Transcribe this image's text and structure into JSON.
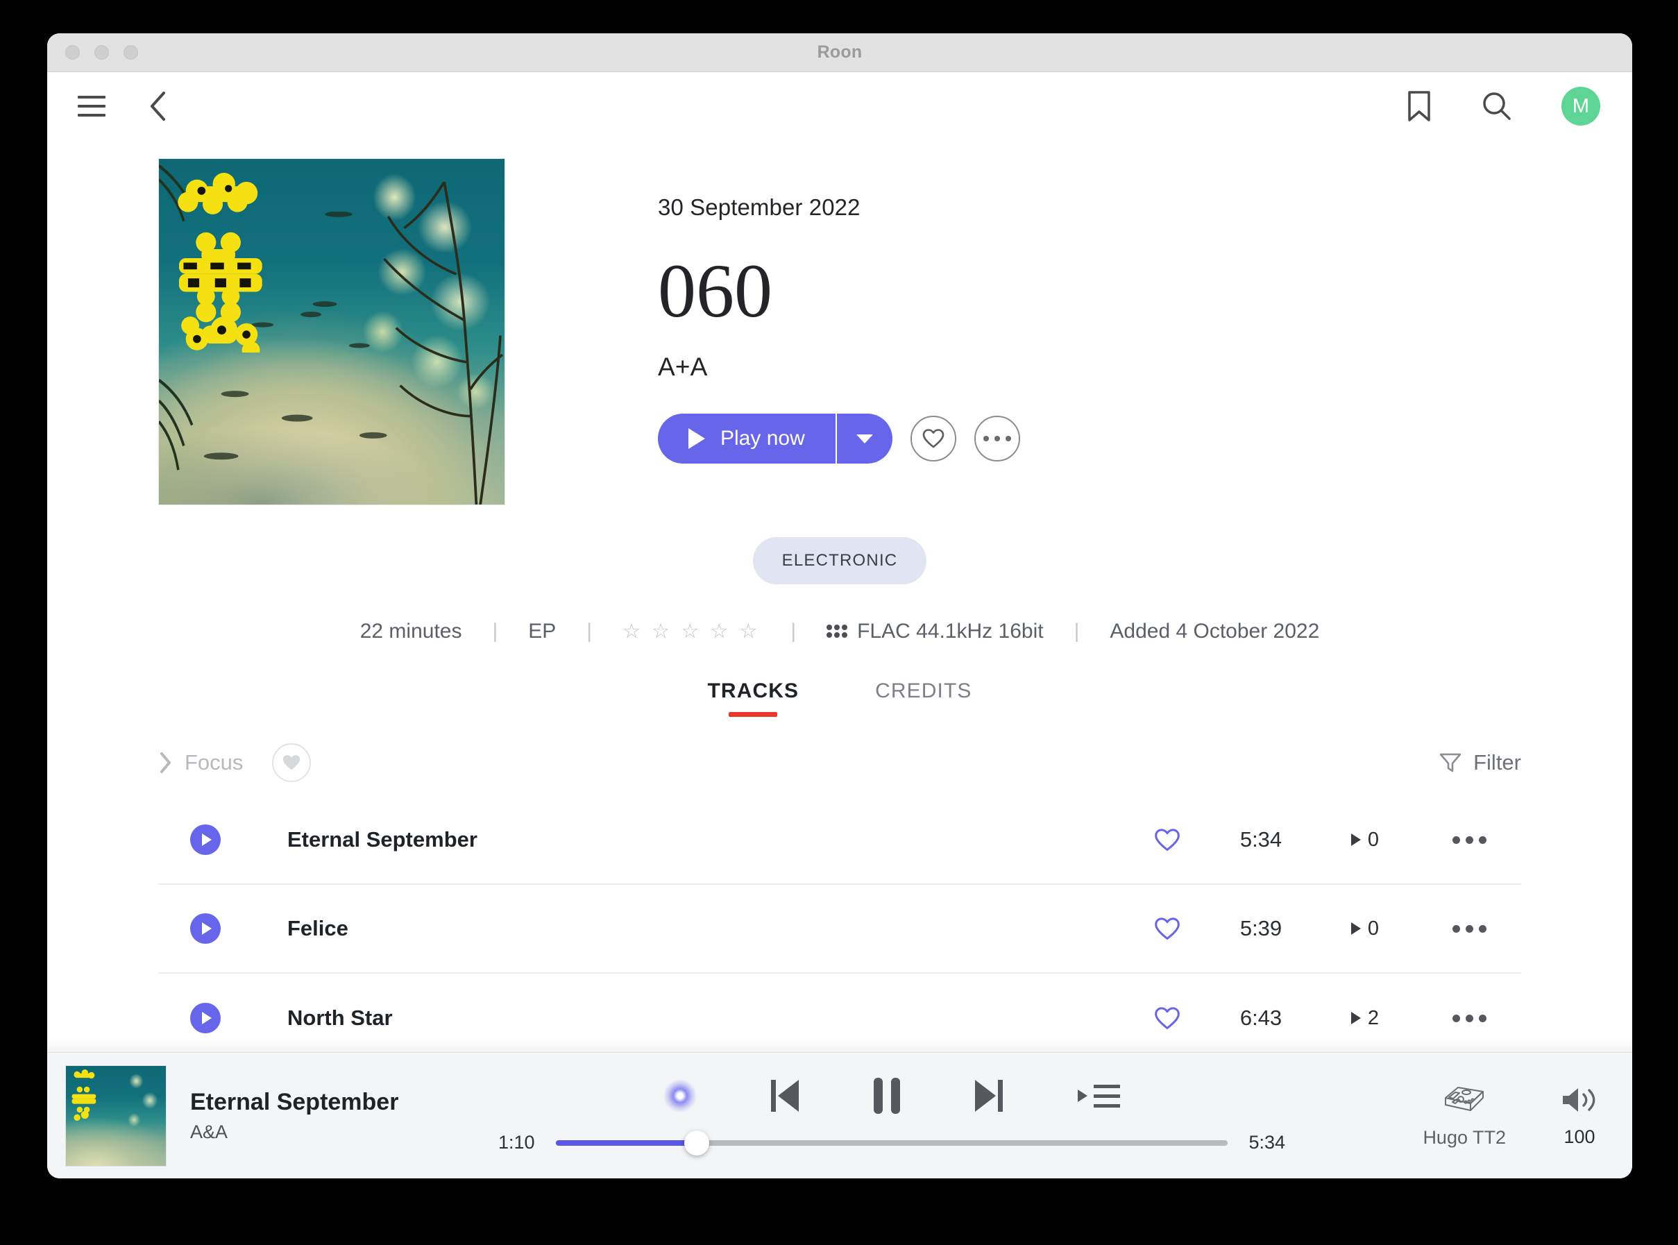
{
  "window": {
    "title": "Roon",
    "traffic_lights": [
      "close",
      "minimize",
      "zoom"
    ]
  },
  "topnav": {
    "menu_icon": "hamburger-icon",
    "back_icon": "chevron-left-icon",
    "bookmark_icon": "bookmark-icon",
    "search_icon": "search-icon",
    "avatar_initial": "M",
    "avatar_color": "#5ed495"
  },
  "album": {
    "release_date": "30 September 2022",
    "title": "060",
    "artist": "A+A",
    "cover_alt": "album-cover-artwork",
    "genre": "ELECTRONIC",
    "actions": {
      "play_label": "Play now",
      "play_color": "#6765ea",
      "dropdown_icon": "chevron-down-icon",
      "favorite_icon": "heart-outline-icon",
      "more_icon": "ellipsis-icon"
    },
    "info": {
      "duration": "22 minutes",
      "type": "EP",
      "rating_stars": "☆ ☆ ☆ ☆ ☆",
      "rating_value": 0,
      "format": "FLAC 44.1kHz 16bit",
      "added": "Added 4 October 2022"
    }
  },
  "tabs": [
    {
      "label": "TRACKS",
      "active": true
    },
    {
      "label": "CREDITS",
      "active": false
    }
  ],
  "toolbar": {
    "focus_label": "Focus",
    "focus_chevron_icon": "chevron-right-icon",
    "favorites_filter_icon": "heart-filled-icon",
    "filter_label": "Filter",
    "filter_icon": "funnel-icon"
  },
  "track_columns": [
    "play",
    "title",
    "favorite",
    "duration",
    "plays",
    "more"
  ],
  "tracks": [
    {
      "title": "Eternal September",
      "duration": "5:34",
      "plays": "0",
      "favorite_icon": "heart-outline-icon",
      "more_icon": "ellipsis-icon"
    },
    {
      "title": "Felice",
      "duration": "5:39",
      "plays": "0",
      "favorite_icon": "heart-outline-icon",
      "more_icon": "ellipsis-icon"
    },
    {
      "title": "North Star",
      "duration": "6:43",
      "plays": "2",
      "favorite_icon": "heart-outline-icon",
      "more_icon": "ellipsis-icon"
    }
  ],
  "player": {
    "now_playing_title": "Eternal September",
    "now_playing_artist": "A&A",
    "radio_icon": "roon-radio-icon",
    "previous_icon": "skip-previous-icon",
    "playpause_icon": "pause-icon",
    "next_icon": "skip-next-icon",
    "queue_icon": "queue-icon",
    "elapsed": "1:10",
    "total": "5:34",
    "progress_percent": 21,
    "accent_color": "#5956e8",
    "zone_name": "Hugo TT2",
    "zone_icon": "audio-device-icon",
    "volume": "100",
    "volume_icon": "speaker-icon"
  }
}
